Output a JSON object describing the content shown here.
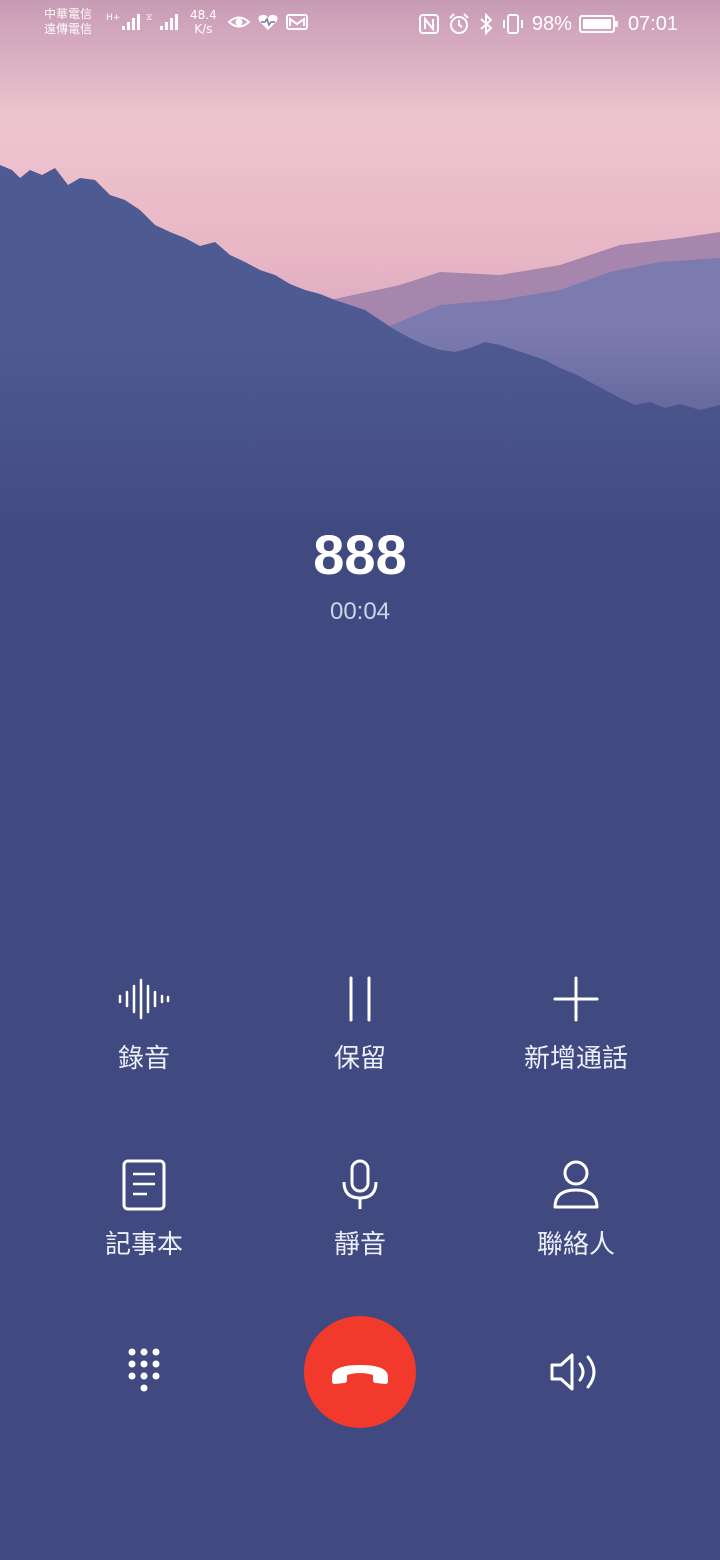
{
  "status_bar": {
    "carrier1": "中華電信",
    "carrier2": "遠傳電信",
    "speed_value": "48.4",
    "speed_unit": "K/s",
    "battery": "98%",
    "time": "07:01",
    "icons": [
      "signal-icon",
      "eye-icon",
      "heart-icon",
      "mail-icon",
      "nfc-icon",
      "alarm-icon",
      "bluetooth-icon",
      "vibrate-icon",
      "battery-icon"
    ]
  },
  "call": {
    "number": "888",
    "duration": "00:04"
  },
  "actions": [
    {
      "label": "錄音",
      "icon": "record-waveform-icon"
    },
    {
      "label": "保留",
      "icon": "pause-icon"
    },
    {
      "label": "新增通話",
      "icon": "plus-icon"
    },
    {
      "label": "記事本",
      "icon": "notepad-icon"
    },
    {
      "label": "靜音",
      "icon": "microphone-icon"
    },
    {
      "label": "聯絡人",
      "icon": "contact-icon"
    }
  ],
  "bottom": {
    "dialpad_icon": "dialpad-icon",
    "end_call_icon": "end-call-icon",
    "speaker_icon": "speaker-icon",
    "end_call_color": "#f23a2c"
  },
  "colors": {
    "background": "#414a80",
    "sky": "#e9b8c6"
  }
}
